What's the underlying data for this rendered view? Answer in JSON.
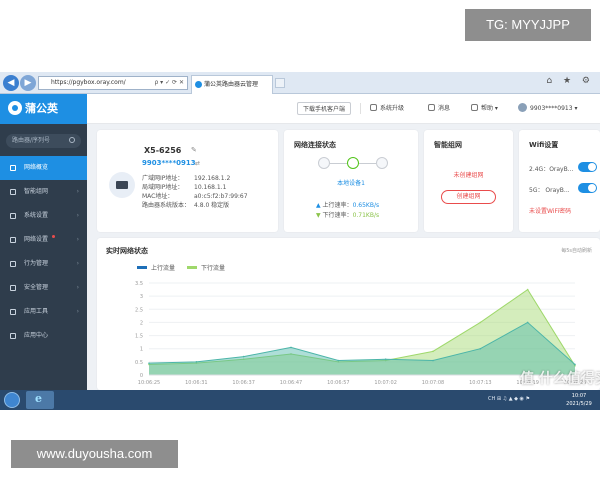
{
  "overlays": {
    "tg_text": "TG: MYYJJPP",
    "site_text": "www.duyousha.com",
    "watermark": "值 什么值得买"
  },
  "browser": {
    "address": "https://pgybox.oray.com/",
    "address_icons": "ρ ▾ ✓ ⟳ ✕",
    "tab_title": "蒲公英路由器云管理",
    "right_icons": "⌂ ★ ⚙"
  },
  "header": {
    "logo": "蒲公英",
    "download_btn": "下载手机客户端",
    "upgrade": "系统升级",
    "messages": "消息",
    "help": "帮助",
    "account": "9903****0913"
  },
  "sidebar": {
    "search_placeholder": "路由器/序列号",
    "items": [
      {
        "label": "网络概览",
        "active": true
      },
      {
        "label": "智能组网"
      },
      {
        "label": "系统设置"
      },
      {
        "label": "网络设置"
      },
      {
        "label": "行为管理"
      },
      {
        "label": "安全管理"
      },
      {
        "label": "应用工具"
      },
      {
        "label": "应用中心"
      }
    ]
  },
  "device": {
    "name": "X5-6256",
    "edit": "✎",
    "account": "9903****0913",
    "link": "⇄",
    "rows": [
      {
        "k": "广域网IP地址：",
        "v": "192.168.1.2"
      },
      {
        "k": "局域网IP地址：",
        "v": "10.168.1.1"
      },
      {
        "k": "MAC地址：",
        "v": "a0:c5:f2:b7:99:67"
      },
      {
        "k": "路由器系统版本：",
        "v": "4.8.0 稳定版"
      }
    ]
  },
  "net_status": {
    "title": "网络连接状态",
    "device_label": "本地设备1",
    "up_label": "上行速率：",
    "up_value": "0.65KB/s",
    "down_label": "下行速率：",
    "down_value": "0.71KB/s"
  },
  "mesh": {
    "title": "智能组网",
    "status": "未创建组网",
    "button": "创建组网"
  },
  "wifi": {
    "title": "Wifi设置",
    "band1": "2.4G：OrayB...",
    "band2": "5G：  OrayB...",
    "link": "未设置WiFi密码"
  },
  "chart_data": {
    "type": "area",
    "title": "实时网络状态",
    "note": "每5s自动刷新",
    "x": [
      "10:06:25",
      "10:06:31",
      "10:06:37",
      "10:06:47",
      "10:06:57",
      "10:07:02",
      "10:07:08",
      "10:07:13",
      "10:07:19",
      "10:07:26"
    ],
    "ylim": [
      0,
      3.5
    ],
    "yticks": [
      0,
      0.5,
      1,
      1.5,
      2,
      2.5,
      3,
      3.5
    ],
    "series": [
      {
        "name": "上行流量",
        "color": "#4cb5a8",
        "values": [
          0.45,
          0.5,
          0.7,
          1.05,
          0.55,
          0.6,
          0.55,
          1.0,
          2.0,
          0.4
        ]
      },
      {
        "name": "下行流量",
        "color": "#9fd86b",
        "values": [
          0.4,
          0.45,
          0.6,
          0.8,
          0.5,
          0.55,
          0.9,
          2.0,
          3.25,
          0.35
        ]
      }
    ]
  },
  "taskbar": {
    "tray": "CH ⊞ ♫ ▲ ◆ ◉ ⚑",
    "time": "10:07",
    "date": "2021/5/29"
  },
  "colors": {
    "accent": "#1e8fe3",
    "sidebar": "#2f3d4c",
    "alert": "#e94c4c",
    "up_series": "#4cb5a8",
    "down_series": "#9fd86b"
  }
}
